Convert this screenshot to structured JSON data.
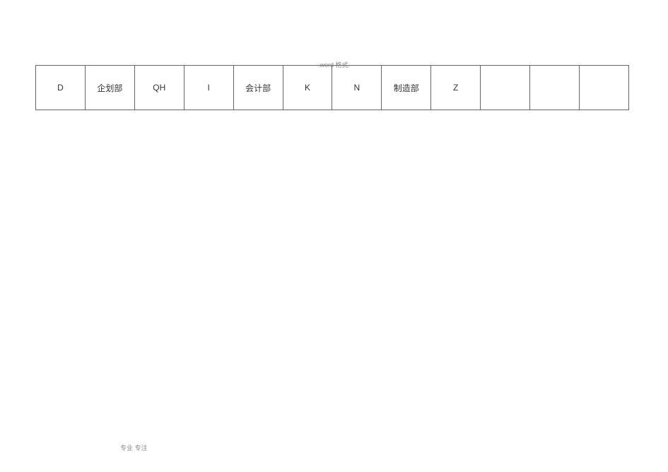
{
  "header_text": ".word 格式.",
  "footer_text": "专业 专注",
  "table": {
    "rows": [
      {
        "cells": [
          "D",
          "企划部",
          "QH",
          "I",
          "会计部",
          "K",
          "N",
          "制造部",
          "Z",
          "",
          "",
          ""
        ]
      }
    ]
  }
}
